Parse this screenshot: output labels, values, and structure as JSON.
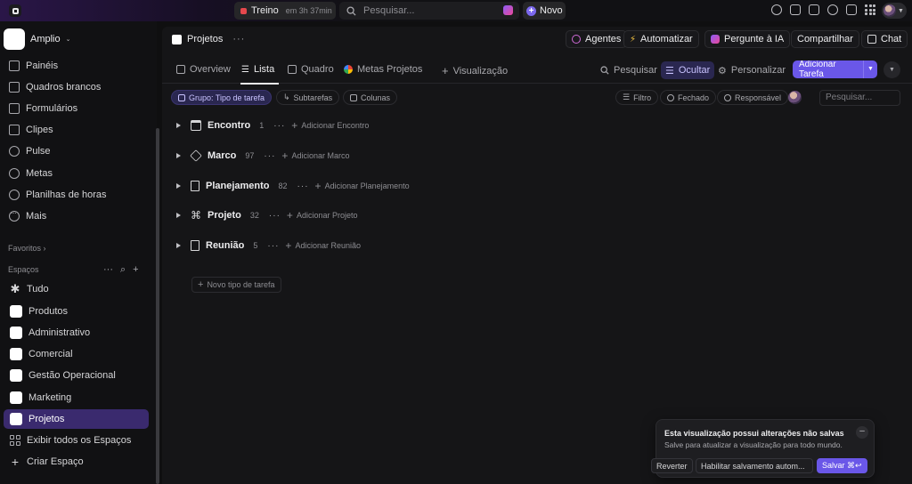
{
  "topbar": {
    "timer": {
      "label": "Treino",
      "elapsed": "em 3h 37min"
    },
    "search_placeholder": "Pesquisar...",
    "new_label": "Novo"
  },
  "sidebar": {
    "workspace": "Amplio",
    "nav": [
      {
        "label": "Painéis",
        "icon": "dashboard-icon"
      },
      {
        "label": "Quadros brancos",
        "icon": "whiteboard-icon"
      },
      {
        "label": "Formulários",
        "icon": "form-icon"
      },
      {
        "label": "Clipes",
        "icon": "clip-icon"
      },
      {
        "label": "Pulse",
        "icon": "pulse-icon"
      },
      {
        "label": "Metas",
        "icon": "trophy-icon"
      },
      {
        "label": "Planilhas de horas",
        "icon": "timesheet-icon"
      },
      {
        "label": "Mais",
        "icon": "more-icon"
      }
    ],
    "favorites_label": "Favoritos",
    "spaces_label": "Espaços",
    "spaces": [
      {
        "label": "Tudo"
      },
      {
        "label": "Produtos"
      },
      {
        "label": "Administrativo"
      },
      {
        "label": "Comercial"
      },
      {
        "label": "Gestão Operacional"
      },
      {
        "label": "Marketing"
      },
      {
        "label": "Projetos",
        "active": true
      },
      {
        "label": "Exibir todos os Espaços"
      },
      {
        "label": "Criar Espaço"
      }
    ]
  },
  "header": {
    "breadcrumb": "Projetos",
    "buttons": {
      "agents": "Agentes",
      "automate": "Automatizar",
      "ask_ai": "Pergunte à IA",
      "share": "Compartilhar",
      "chat": "Chat"
    }
  },
  "tabs": {
    "items": [
      "Overview",
      "Lista",
      "Quadro",
      "Metas Projetos",
      "Visualização"
    ],
    "active": "Lista",
    "search": "Pesquisar",
    "hide": "Ocultar",
    "customize": "Personalizar",
    "add_task": "Adicionar Tarefa"
  },
  "filters": {
    "group": "Grupo: Tipo de tarefa",
    "subtasks": "Subtarefas",
    "columns": "Colunas",
    "filter": "Filtro",
    "closed": "Fechado",
    "assignee": "Responsável",
    "search_placeholder": "Pesquisar..."
  },
  "groups": [
    {
      "name": "Encontro",
      "count": "1",
      "add": "Adicionar Encontro",
      "icon": "calendar-icon"
    },
    {
      "name": "Marco",
      "count": "97",
      "add": "Adicionar Marco",
      "icon": "milestone-icon"
    },
    {
      "name": "Planejamento",
      "count": "82",
      "add": "Adicionar Planejamento",
      "icon": "document-icon"
    },
    {
      "name": "Projeto",
      "count": "32",
      "add": "Adicionar Projeto",
      "icon": "project-icon"
    },
    {
      "name": "Reunião",
      "count": "5",
      "add": "Adicionar Reunião",
      "icon": "document-icon"
    }
  ],
  "new_task_type": "Novo tipo de tarefa",
  "toast": {
    "title": "Esta visualização possui alterações não salvas",
    "subtitle": "Salve para atualizar a visualização para todo mundo.",
    "revert": "Reverter",
    "autosave": "Habilitar salvamento autom...",
    "save": "Salvar ⌘↩"
  },
  "colors": {
    "accent": "#6a57e8",
    "active_space": "#3a2a6e",
    "timer_dot": "#e5484d"
  }
}
